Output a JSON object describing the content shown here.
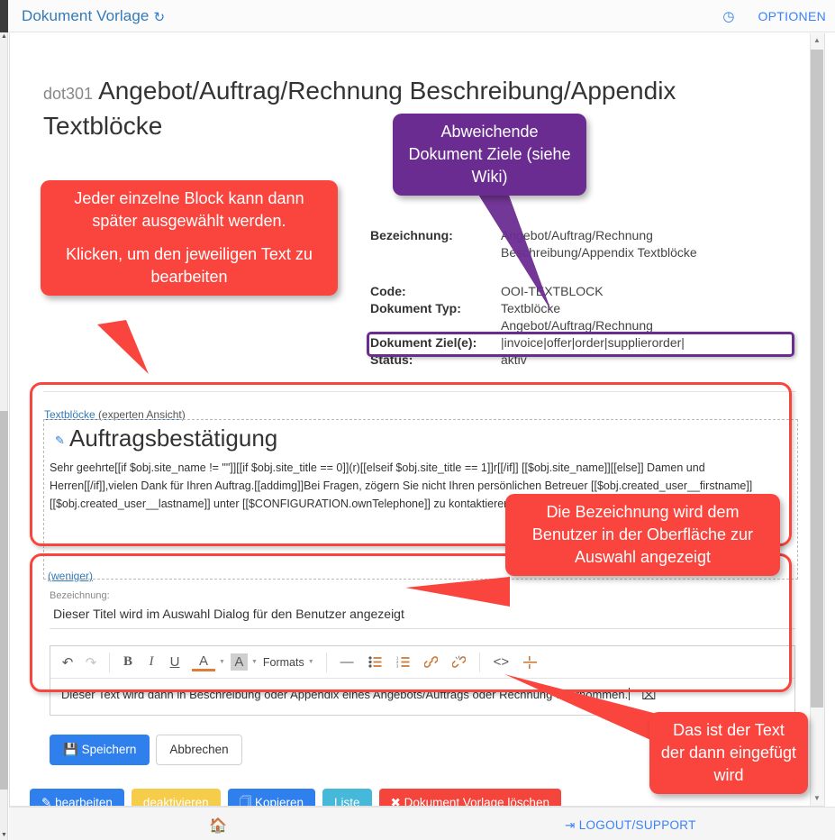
{
  "topbar": {
    "title": "Dokument Vorlage",
    "refresh_icon": "refresh-icon",
    "clock_icon": "clock-icon",
    "options_label": "OPTIONEN"
  },
  "page": {
    "code": "dot301",
    "title": "Angebot/Auftrag/Rechnung Beschreibung/Appendix Textblöcke"
  },
  "details": {
    "rows": [
      {
        "label": "Bezeichnung:",
        "value": "Angebot/Auftrag/Rechnung"
      },
      {
        "label": "",
        "value": "Beschreibung/Appendix Textblöcke"
      },
      {
        "label": "Code:",
        "value": "OOI-TEXTBLOCK"
      },
      {
        "label": "Dokument Typ:",
        "value": "Textblöcke"
      },
      {
        "label": "",
        "value": "Angebot/Auftrag/Rechnung"
      },
      {
        "label": "Dokument Ziel(e):",
        "value": "|invoice|offer|order|supplierorder|"
      },
      {
        "label": "Status:",
        "value": "aktiv"
      }
    ]
  },
  "textblock": {
    "expert_link_label": "Textblöcke",
    "expert_link_suffix": "(experten Ansicht)",
    "edit_icon": "pencil-icon",
    "title": "Auftragsbestätigung",
    "body": "Sehr geehrte[[if $obj.site_name != \"\"]][[if $obj.site_title == 0]](r)[[elseif $obj.site_title == 1]]r[[/if]] [[$obj.site_name]][[else]] Damen und Herren[[/if]],vielen Dank für Ihren Auftrag.[[addimg]]Bei Fragen, zögern Sie nicht Ihren persönlichen Betreuer [[$obj.created_user__firstname]] [[$obj.created_user__lastname]] unter [[$CONFIGURATION.ownTelephone]] zu kontaktieren.Ihre [[$CONFIGURATION.ownCompany]]",
    "less_link": "(weniger)"
  },
  "form": {
    "bezeichnung_label": "Bezeichnung:",
    "bezeichnung_value": "Dieser Titel wird im Auswahl Dialog für den Benutzer angezeigt",
    "editor_content": "Dieser Text wird dann in Beschreibung oder Appendix eines Angebots/Auftrags oder Rechnung übernommen.",
    "toolbar": {
      "undo": "↶",
      "redo": "↷",
      "bold": "B",
      "italic": "I",
      "underline": "U",
      "text_color": "A",
      "background_color": "A",
      "formats_label": "Formats",
      "horizontal_rule": "—",
      "bullet_list": "bullet-list",
      "numbered_list": "numbered-list",
      "link": "link",
      "unlink": "unlink",
      "source_code": "<>",
      "page_break": "page-break"
    },
    "save_label": "Speichern",
    "save_icon": "save-disk-icon",
    "cancel_label": "Abbrechen"
  },
  "actions": [
    {
      "label": "bearbeiten",
      "icon": "pencil-icon",
      "color": "#2f80ed"
    },
    {
      "label": "deaktivieren",
      "icon": "",
      "color": "#f6cc4b"
    },
    {
      "label": "Kopieren",
      "icon": "copy-icon",
      "color": "#2f80ed"
    },
    {
      "label": "Liste",
      "icon": "",
      "color": "#46b8da"
    },
    {
      "label": "Dokument Vorlage löschen",
      "icon": "cross-icon",
      "color": "#f4453c"
    }
  ],
  "footer": {
    "home_icon": "home-icon",
    "logout_icon": "logout-icon",
    "logout_label": "LOGOUT/SUPPORT"
  },
  "annotations": [
    {
      "id": "annotation-block-select",
      "color": "#f9453e",
      "line1": "Jeder einzelne Block kann dann später ausgewählt werden.",
      "line2": "Klicken, um den jeweiligen Text zu bearbeiten"
    },
    {
      "id": "annotation-document-targets",
      "color": "#6b2c91",
      "text": "Abweichende Dokument Ziele (siehe Wiki)"
    },
    {
      "id": "annotation-bezeichnung",
      "color": "#f9453e",
      "text": "Die Bezeichnung wird dem Benutzer in der Oberfläche zur Auswahl angezeigt"
    },
    {
      "id": "annotation-inserted-text",
      "color": "#f9453e",
      "text": "Das ist der Text der dann eingefügt wird"
    }
  ]
}
